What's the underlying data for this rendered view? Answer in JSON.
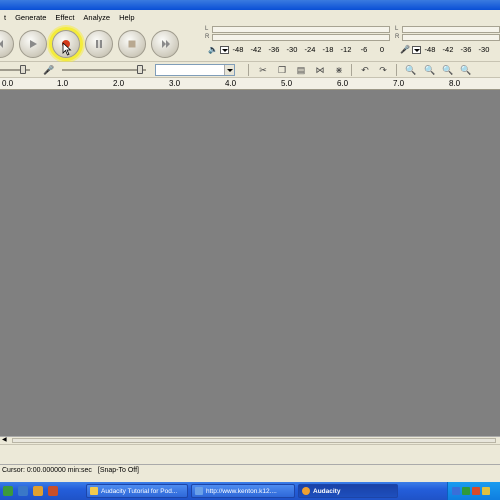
{
  "menubar": {
    "items": [
      "t",
      "Generate",
      "Effect",
      "Analyze",
      "Help"
    ]
  },
  "transport": {
    "buttons": [
      "skip-start",
      "play",
      "record",
      "pause",
      "stop",
      "skip-end"
    ],
    "active": "record"
  },
  "meters": {
    "play_channels": [
      "L",
      "R"
    ],
    "record_channels": [
      "L",
      "R"
    ],
    "play_scale": [
      "-48",
      "-42",
      "-36",
      "-30",
      "-24",
      "-18",
      "-12",
      "-6",
      "0"
    ],
    "record_scale": [
      "-48",
      "-42",
      "-36",
      "-30"
    ]
  },
  "ruler": {
    "labels": [
      "0.0",
      "1.0",
      "2.0",
      "3.0",
      "4.0",
      "5.0",
      "6.0",
      "7.0",
      "8.0"
    ]
  },
  "status": {
    "cursor": "Cursor: 0:00.000000 min:sec",
    "snap": "[Snap-To Off]"
  },
  "taskbar": {
    "tasks": [
      {
        "label": "Audacity Tutorial for Pod...",
        "active": false
      },
      {
        "label": "http://www.kenton.k12....",
        "active": false
      },
      {
        "label": "Audacity",
        "active": true
      }
    ]
  },
  "colors": {
    "track_bg": "#808080",
    "chrome": "#ece9d8",
    "record_highlight": "#f4ec3a",
    "record_dot": "#d43a1a",
    "taskbar_blue": "#245edb"
  }
}
